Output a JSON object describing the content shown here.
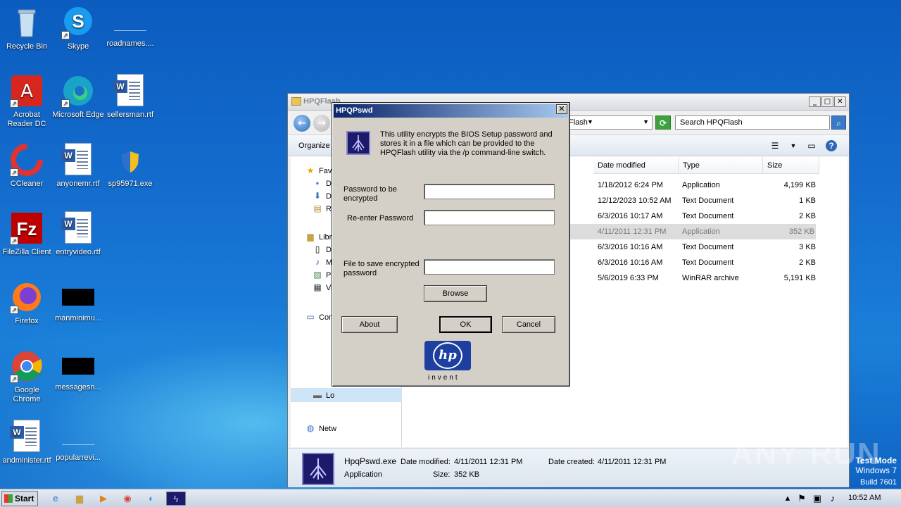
{
  "desktop": {
    "icons": [
      {
        "label": "Recycle Bin"
      },
      {
        "label": "Skype"
      },
      {
        "label": "roadnames...."
      },
      {
        "label": "Acrobat Reader DC"
      },
      {
        "label": "Microsoft Edge"
      },
      {
        "label": "sellersman.rtf"
      },
      {
        "label": "CCleaner"
      },
      {
        "label": "anyonemr.rtf"
      },
      {
        "label": "sp95971.exe"
      },
      {
        "label": "FileZilla Client"
      },
      {
        "label": "entryvideo.rtf"
      },
      {
        "label": "Firefox"
      },
      {
        "label": "manminimu..."
      },
      {
        "label": "Google Chrome"
      },
      {
        "label": "messagesn..."
      },
      {
        "label": "andminister.rtf"
      },
      {
        "label": "popularrevi..."
      }
    ]
  },
  "explorer": {
    "title": "HPQFlash",
    "address_value": "Flash",
    "search_placeholder": "Search HPQFlash",
    "organize_label": "Organize",
    "nav_items": [
      "Fav",
      "De",
      "Do",
      "Re",
      "Libra",
      "Do",
      "Mu",
      "Pi",
      "Vi",
      "Com",
      "Lo",
      "Netw"
    ],
    "columns": [
      "Date modified",
      "Type",
      "Size"
    ],
    "rows": [
      {
        "date": "1/18/2012 6:24 PM",
        "type": "Application",
        "size": "4,199 KB"
      },
      {
        "date": "12/12/2023 10:52 AM",
        "type": "Text Document",
        "size": "1 KB"
      },
      {
        "date": "6/3/2016 10:17 AM",
        "type": "Text Document",
        "size": "2 KB"
      },
      {
        "date": "4/11/2011 12:31 PM",
        "type": "Application",
        "size": "352 KB"
      },
      {
        "date": "6/3/2016 10:16 AM",
        "type": "Text Document",
        "size": "3 KB"
      },
      {
        "date": "6/3/2016 10:16 AM",
        "type": "Text Document",
        "size": "2 KB"
      },
      {
        "date": "5/6/2019 6:33 PM",
        "type": "WinRAR archive",
        "size": "5,191 KB"
      }
    ],
    "details": {
      "name": "HpqPswd.exe",
      "modified_label": "Date modified:",
      "modified_value": "4/11/2011 12:31 PM",
      "created_label": "Date created:",
      "created_value": "4/11/2011 12:31 PM",
      "type": "Application",
      "size_label": "Size:",
      "size_value": "352 KB"
    }
  },
  "dialog": {
    "title": "HPQPswd",
    "intro": "This utility encrypts the BIOS Setup password and stores it in a file which can be provided to the HPQFlash utility via the /p command-line switch.",
    "password_label": "Password to be encrypted",
    "reenter_label": "Re-enter Password",
    "file_label": "File to save encrypted password",
    "browse_label": "Browse",
    "about_label": "About",
    "ok_label": "OK",
    "cancel_label": "Cancel",
    "logo_text": "hp",
    "tagline": "invent"
  },
  "taskbar": {
    "start_label": "Start",
    "clock": "10:52 AM"
  },
  "watermark": {
    "line1": "Test Mode",
    "line2": "Windows 7",
    "line3": "Build 7601",
    "brand": "ANY RUN"
  }
}
